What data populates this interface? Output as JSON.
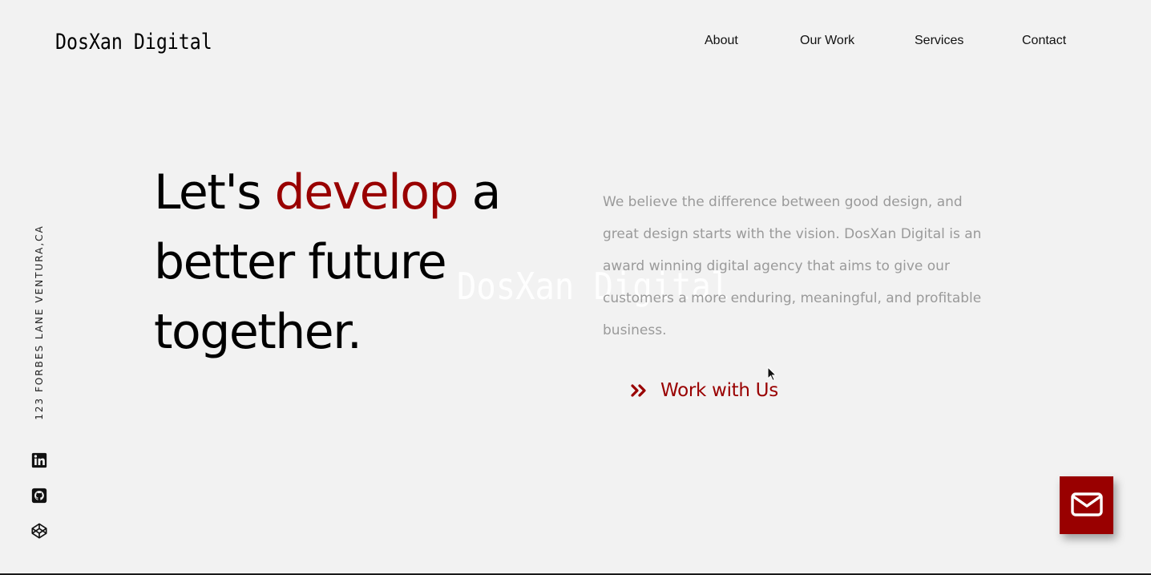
{
  "brand": {
    "name": "DosXan Digital"
  },
  "nav": {
    "items": [
      {
        "label": "About"
      },
      {
        "label": "Our Work"
      },
      {
        "label": "Services"
      },
      {
        "label": "Contact"
      }
    ]
  },
  "sidebar": {
    "address": "123 FORBES LANE VENTURA,CA",
    "socials": [
      {
        "icon": "linkedin-icon"
      },
      {
        "icon": "github-icon"
      },
      {
        "icon": "codepen-icon"
      }
    ]
  },
  "hero": {
    "headline_part1": "Let's ",
    "headline_accent": "develop",
    "headline_part2": " a better future together.",
    "watermark": "DosXan Digital",
    "intro": "We believe the difference between good design, and great design starts with the vision. DosXan Digital is an award winning digital agency that aims to give our customers a more enduring, meaningful, and profitable business.",
    "cta_label": "Work with Us",
    "cta_icon": "double-chevron-right-icon"
  },
  "fab": {
    "icon": "mail-icon"
  },
  "colors": {
    "accent": "#990000",
    "background": "#f2f2f2",
    "muted_text": "#9a9a9a"
  }
}
